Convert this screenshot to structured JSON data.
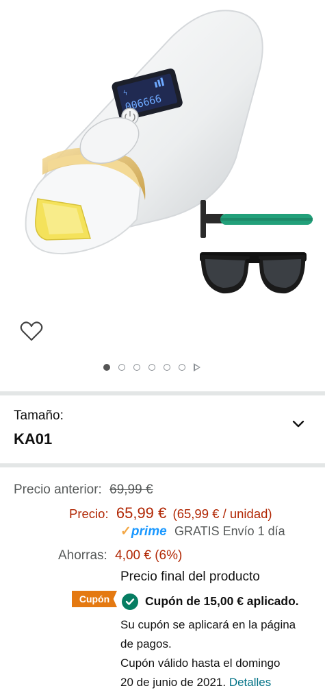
{
  "product": {
    "size_label": "Tamaño:",
    "size_value": "KA01",
    "screen_digits": "006666"
  },
  "pricing": {
    "previous_label": "Precio anterior:",
    "previous_value": "69,99 €",
    "price_label": "Precio:",
    "price_value": "65,99 €",
    "unit_price": "(65,99 € / unidad)",
    "prime_check": "✓",
    "prime_logo": "prime",
    "shipping": "GRATIS Envío 1 día",
    "savings_label": "Ahorras:",
    "savings_value": "4,00 € (6%)",
    "final_price_note": "Precio final del producto"
  },
  "coupon": {
    "badge": "Cupón",
    "applied_text": "Cupón de 15,00 € aplicado.",
    "note_line1": "Su cupón se aplicará en la página",
    "note_line2": "de pagos.",
    "valid_line1": "Cupón válido hasta el domingo",
    "valid_line2": "20 de junio de 2021.",
    "details_link": "Detalles"
  },
  "carousel": {
    "total_images": 6,
    "active_index": 1
  },
  "colors": {
    "price": "#b12704",
    "prime": "#1a98ff",
    "badge": "#e47911",
    "check": "#067d62",
    "link": "#007185"
  }
}
